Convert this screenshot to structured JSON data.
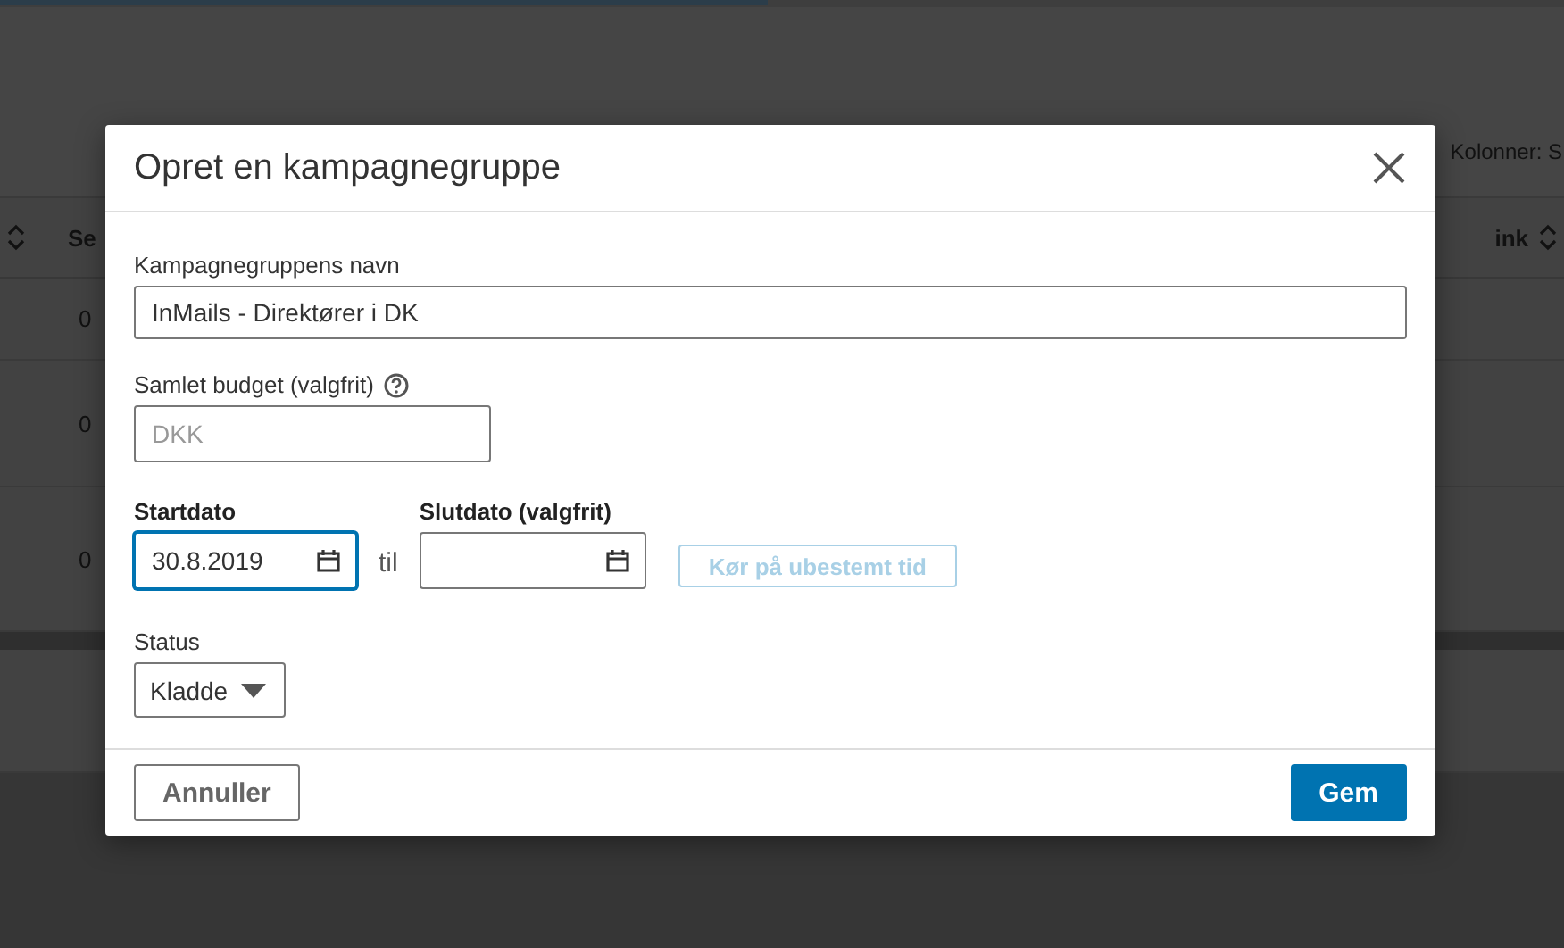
{
  "background": {
    "columns_label": "Kolonner: S",
    "table": {
      "columns": [
        "Se",
        "ink"
      ],
      "rows": [
        {
          "cells": [
            "0"
          ]
        },
        {
          "cells": [
            "0"
          ]
        },
        {
          "cells": [
            "0"
          ]
        }
      ]
    }
  },
  "dialog": {
    "title": "Opret en kampagnegruppe",
    "name_field": {
      "label": "Kampagnegruppens navn",
      "value": "InMails - Direktører i DK"
    },
    "budget_field": {
      "label": "Samlet budget (valgfrit)",
      "placeholder": "DKK"
    },
    "start_date": {
      "label": "Startdato",
      "value": "30.8.2019",
      "focused": true
    },
    "range_separator": "til",
    "end_date": {
      "label": "Slutdato (valgfrit)",
      "focused": false
    },
    "indefinite_button": {
      "label": "Kør på ubestemt tid",
      "disabled": true
    },
    "status": {
      "label": "Status",
      "value": "Kladde"
    },
    "buttons": [
      {
        "label": "Annuller",
        "kind": "secondary"
      },
      {
        "label": "Gem",
        "kind": "primary"
      }
    ]
  }
}
